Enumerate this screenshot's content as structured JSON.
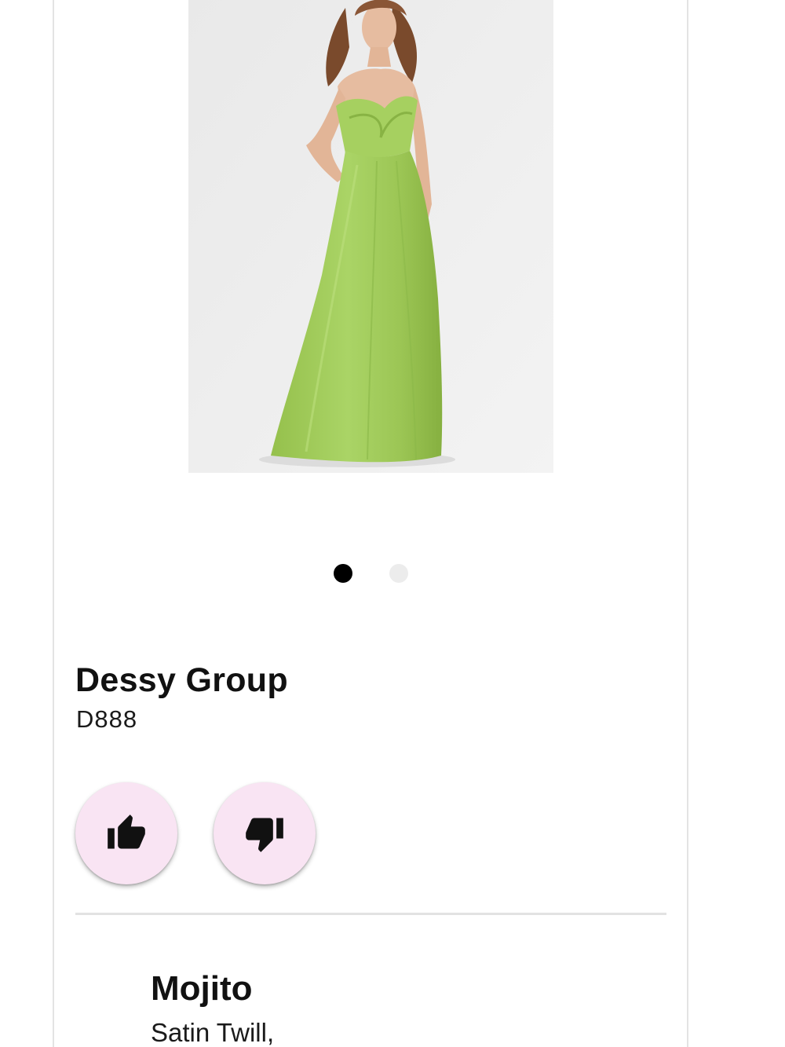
{
  "product": {
    "brand": "Dessy Group",
    "style_number": "D888",
    "image_alt": "Model wearing a green strapless satin gown",
    "image_colors": {
      "background": "#eeeeee",
      "dress": "#a3cc5c",
      "dress_shadow": "#86b040",
      "skin": "#e6bca0",
      "hair": "#8a5636"
    }
  },
  "carousel": {
    "dots": [
      {
        "state": "active"
      },
      {
        "state": "inactive"
      }
    ]
  },
  "actions": {
    "like_icon": "thumb-up-icon",
    "dislike_icon": "thumb-down-icon",
    "button_bg": "#f9e4f3"
  },
  "color_detail": {
    "color_name": "Mojito",
    "fabric": "Satin Twill,"
  }
}
